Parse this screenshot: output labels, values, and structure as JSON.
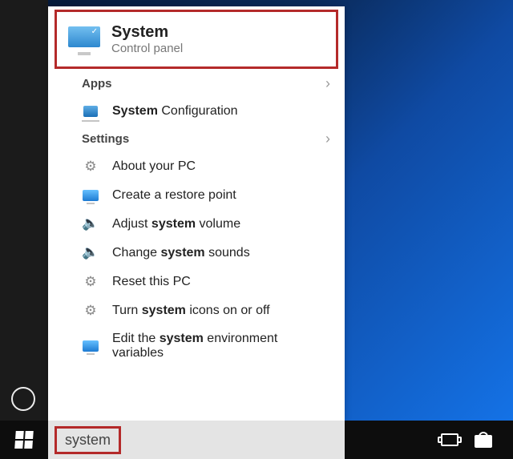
{
  "best_match": {
    "title": "System",
    "subtitle": "Control panel"
  },
  "sections": {
    "apps": {
      "header": "Apps",
      "items": [
        {
          "pre": "",
          "bold": "System",
          "post": " Configuration",
          "icon": "app"
        }
      ]
    },
    "settings": {
      "header": "Settings",
      "items": [
        {
          "pre": "About your PC",
          "bold": "",
          "post": "",
          "icon": "gear"
        },
        {
          "pre": "Create a restore point",
          "bold": "",
          "post": "",
          "icon": "monitor"
        },
        {
          "pre": "Adjust ",
          "bold": "system",
          "post": " volume",
          "icon": "speaker"
        },
        {
          "pre": "Change ",
          "bold": "system",
          "post": " sounds",
          "icon": "speaker"
        },
        {
          "pre": "Reset this PC",
          "bold": "",
          "post": "",
          "icon": "gear"
        },
        {
          "pre": "Turn ",
          "bold": "system",
          "post": " icons on or off",
          "icon": "gear"
        },
        {
          "pre": "Edit the ",
          "bold": "system",
          "post": " environment variables",
          "icon": "monitor"
        }
      ]
    }
  },
  "search_query": "system"
}
